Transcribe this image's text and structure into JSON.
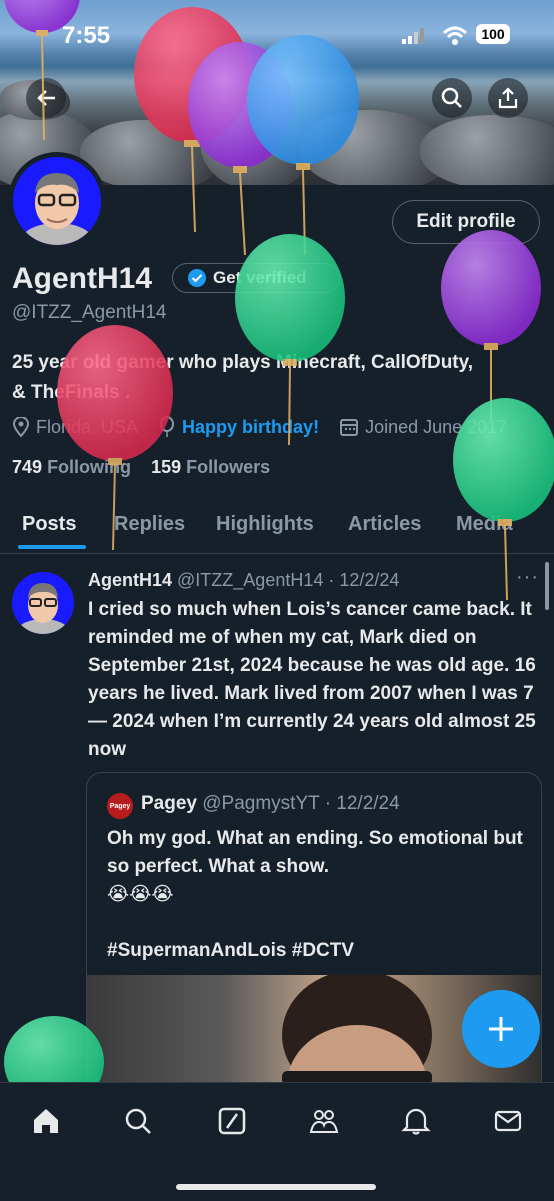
{
  "status_bar": {
    "time": "7:55",
    "battery": "100"
  },
  "profile": {
    "display_name": "AgentH14",
    "get_verified_label": "Get verified",
    "handle": "@ITZZ_AgentH14",
    "edit_profile_label": "Edit profile",
    "bio_line1": "25 year old gamer who plays Minecraft, CallOfDuty,",
    "bio_line2": "& TheFinals .",
    "location": "Florida, USA",
    "birthday_link": "Happy birthday!",
    "joined": "Joined June 2017",
    "following_count": "749",
    "following_label": "Following",
    "followers_count": "159",
    "followers_label": "Followers"
  },
  "tabs": [
    {
      "label": "Posts"
    },
    {
      "label": "Replies"
    },
    {
      "label": "Highlights"
    },
    {
      "label": "Articles"
    },
    {
      "label": "Media"
    }
  ],
  "tweet": {
    "author": "AgentH14",
    "handle": "@ITZZ_AgentH14",
    "date": "· 12/2/24",
    "more": "···",
    "text": "I cried so much when Lois’s cancer came back.  It reminded me of when my cat, Mark died on September 21st, 2024 because he was old age. 16 years he lived. Mark lived from 2007 when I was 7 — 2024 when I’m currently 24 years old almost 25 now",
    "quote": {
      "avatar_text": "Pagey",
      "author": "Pagey",
      "handle": "@PagmystYT",
      "date": "· 12/2/24",
      "text1": "Oh my god. What an ending. So emotional but so perfect. What a show.",
      "emojis": "😭😭😭",
      "hashtags": "#SupermanAndLois #DCTV"
    }
  },
  "colors": {
    "background": "#15202b",
    "accent": "#1d9bf0",
    "secondary_text": "#8b98a5",
    "border": "#38444d",
    "balloon_red": "#e8355a",
    "balloon_purple": "#9b30e0",
    "balloon_blue": "#3aa0f0",
    "balloon_green": "#22d48c"
  },
  "icons": [
    "back-arrow-icon",
    "search-icon",
    "share-icon",
    "verified-badge-icon",
    "location-icon",
    "balloon-birthday-icon",
    "calendar-icon",
    "plus-icon",
    "home-icon",
    "nav-search-icon",
    "grok-icon",
    "communities-icon",
    "notifications-icon",
    "messages-icon"
  ]
}
